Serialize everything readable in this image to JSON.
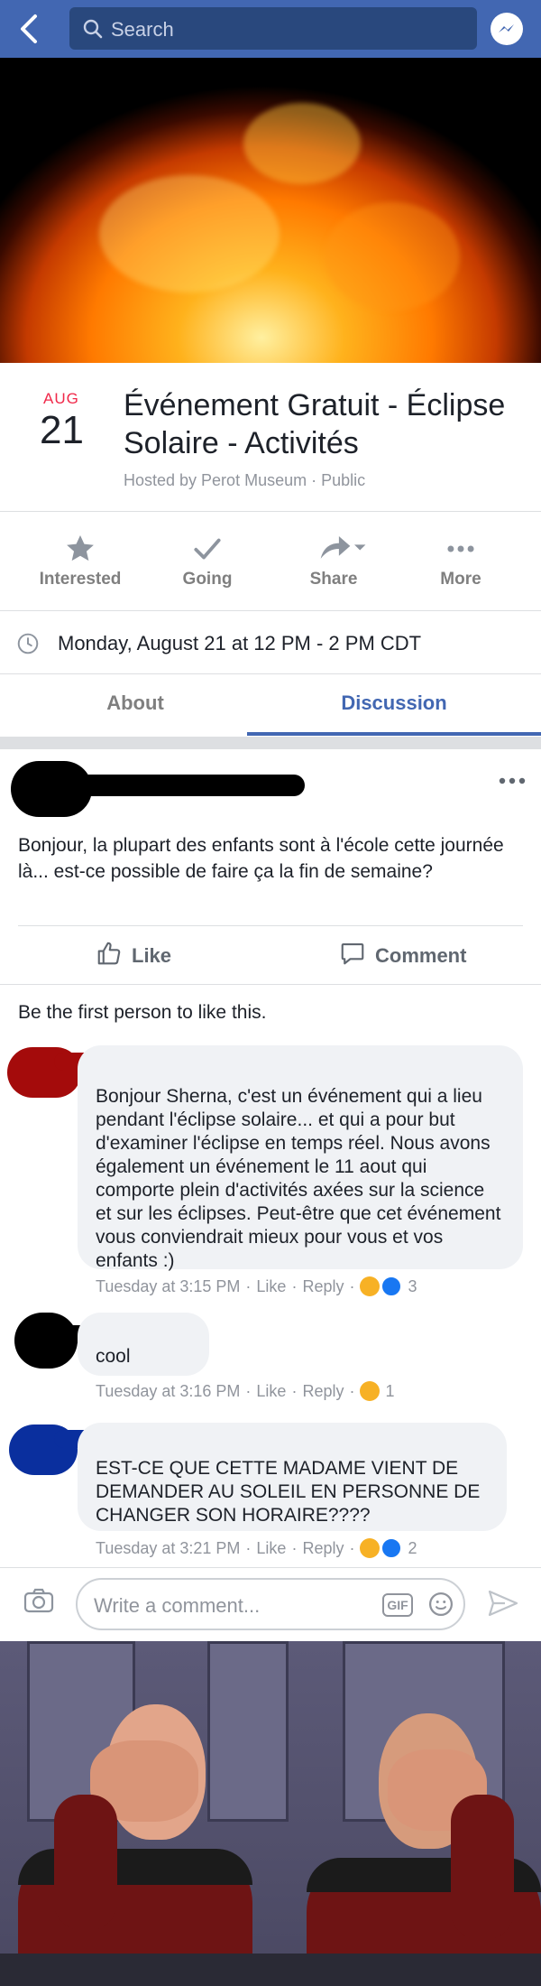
{
  "search": {
    "placeholder": "Search"
  },
  "event": {
    "month": "AUG",
    "day": "21",
    "title": "Événement Gratuit - Éclipse Solaire - Activités",
    "host": "Hosted by Perot Museum · Public",
    "time": "Monday, August 21 at 12 PM - 2 PM CDT"
  },
  "actions": [
    {
      "label": "Interested",
      "icon": "star-icon"
    },
    {
      "label": "Going",
      "icon": "check-icon"
    },
    {
      "label": "Share",
      "icon": "share-arrow-icon"
    },
    {
      "label": "More",
      "icon": "more-dots-icon"
    }
  ],
  "tabs": {
    "about": "About",
    "discussion": "Discussion",
    "active": "Discussion"
  },
  "post": {
    "text": "Bonjour, la plupart des enfants sont à l'école cette journée là... est-ce possible de faire ça la fin de semaine?",
    "like_label": "Like",
    "comment_label": "Comment",
    "likes_line": "Be the first person to like this."
  },
  "comments": [
    {
      "text": "Bonjour Sherna, c'est un événement qui a lieu pendant l'éclipse solaire... et qui a pour but d'examiner l'éclipse en temps réel. Nous avons également un événement le 11 aout qui comporte plein d'activités axées sur la science et sur les éclipses. Peut-être que cet événement vous conviendrait mieux pour vous et vos enfants :)",
      "time": "Tuesday at 3:15 PM",
      "like": "Like",
      "reply": "Reply",
      "reaction_count": "3",
      "redaction_color": "#a40b0b"
    },
    {
      "text": "cool",
      "time": "Tuesday at 3:16 PM",
      "like": "Like",
      "reply": "Reply",
      "reaction_count": "1",
      "redaction_color": "#000000"
    },
    {
      "text": "EST-CE QUE CETTE MADAME VIENT DE DEMANDER AU SOLEIL EN PERSONNE DE CHANGER SON HORAIRE????",
      "time": "Tuesday at 3:21 PM",
      "like": "Like",
      "reply": "Reply",
      "reaction_count": "2",
      "redaction_color": "#0a2f9e"
    }
  ],
  "composer": {
    "placeholder": "Write a comment...",
    "gif_label": "GIF"
  },
  "colors": {
    "brand": "#4267b2",
    "accent_red": "#f02849",
    "text_gray": "#90949c"
  }
}
